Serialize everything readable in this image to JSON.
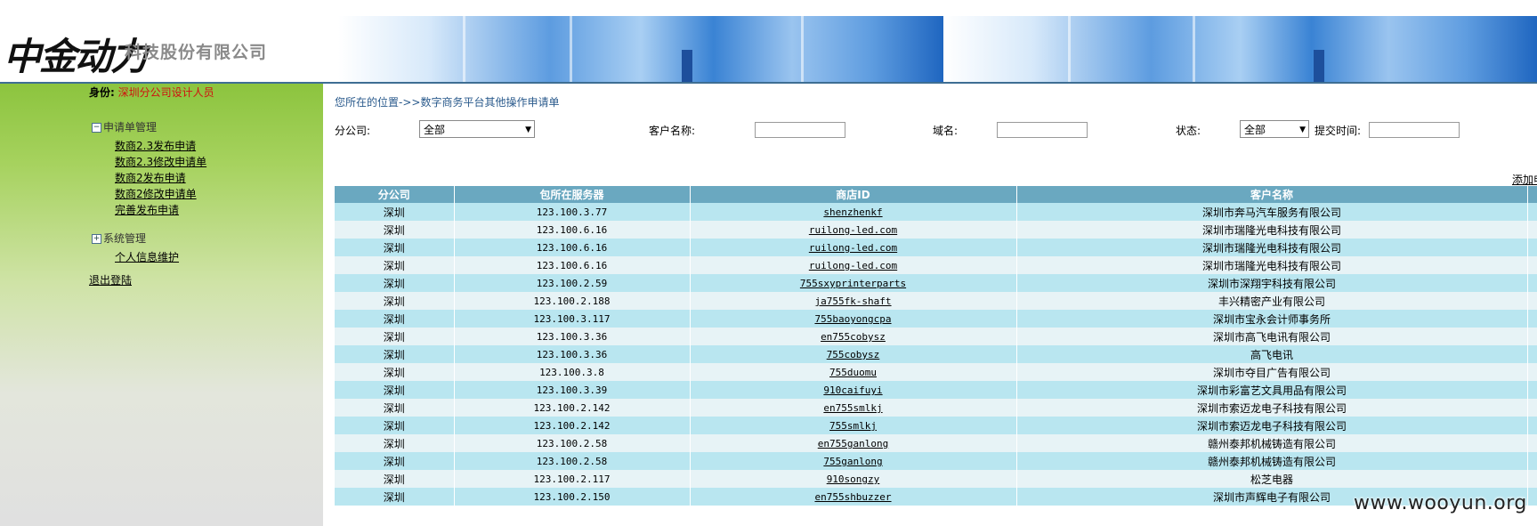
{
  "header": {
    "logo_script": "中金动力",
    "company_name": "科技股份有限公司"
  },
  "sidebar": {
    "identity_label": "身份:",
    "identity_value": "深圳分公司设计人员",
    "groups": [
      {
        "label": "申请单管理",
        "toggle": "⊟",
        "items": [
          "数商2.3发布申请",
          "数商2.3修改申请单",
          "数商2发布申请",
          "数商2修改申请单",
          "完善发布申请"
        ]
      },
      {
        "label": "系统管理",
        "toggle": "⊞",
        "items": [
          "个人信息维护"
        ]
      }
    ],
    "logout": "退出登陆"
  },
  "main": {
    "breadcrumb": "您所在的位置->>数字商务平台其他操作申请单",
    "filters": {
      "branch_label": "分公司:",
      "branch_value": "全部",
      "customer_label": "客户名称:",
      "domain_label": "域名:",
      "status_label": "状态:",
      "status_value": "全部",
      "submit_time_label": "提交时间:"
    },
    "add_link": "添加申请"
  },
  "table": {
    "headers": [
      "分公司",
      "包所在服务器",
      "商店ID",
      "客户名称",
      ""
    ],
    "rows": [
      [
        "深圳",
        "123.100.3.77",
        "shenzhenkf",
        "深圳市奔马汽车服务有限公司"
      ],
      [
        "深圳",
        "123.100.6.16",
        "ruilong-led.com",
        "深圳市瑞隆光电科技有限公司"
      ],
      [
        "深圳",
        "123.100.6.16",
        "ruilong-led.com",
        "深圳市瑞隆光电科技有限公司"
      ],
      [
        "深圳",
        "123.100.6.16",
        "ruilong-led.com",
        "深圳市瑞隆光电科技有限公司"
      ],
      [
        "深圳",
        "123.100.2.59",
        "755sxyprinterparts",
        "深圳市深翔宇科技有限公司"
      ],
      [
        "深圳",
        "123.100.2.188",
        "ja755fk-shaft",
        "丰兴精密产业有限公司"
      ],
      [
        "深圳",
        "123.100.3.117",
        "755baoyongcpa",
        "深圳市宝永会计师事务所"
      ],
      [
        "深圳",
        "123.100.3.36",
        "en755cobysz",
        "深圳市高飞电讯有限公司"
      ],
      [
        "深圳",
        "123.100.3.36",
        "755cobysz",
        "高飞电讯"
      ],
      [
        "深圳",
        "123.100.3.8",
        "755duomu",
        "深圳市夺目广告有限公司"
      ],
      [
        "深圳",
        "123.100.3.39",
        "910caifuyi",
        "深圳市彩富艺文具用品有限公司"
      ],
      [
        "深圳",
        "123.100.2.142",
        "en755smlkj",
        "深圳市索迈龙电子科技有限公司"
      ],
      [
        "深圳",
        "123.100.2.142",
        "755smlkj",
        "深圳市索迈龙电子科技有限公司"
      ],
      [
        "深圳",
        "123.100.2.58",
        "en755ganlong",
        "赣州泰邦机械铸造有限公司"
      ],
      [
        "深圳",
        "123.100.2.58",
        "755ganlong",
        "赣州泰邦机械铸造有限公司"
      ],
      [
        "深圳",
        "123.100.2.117",
        "910songzy",
        "松芝电器"
      ],
      [
        "深圳",
        "123.100.2.150",
        "en755shbuzzer",
        "深圳市声辉电子有限公司"
      ]
    ]
  },
  "watermark": "www.wooyun.org"
}
